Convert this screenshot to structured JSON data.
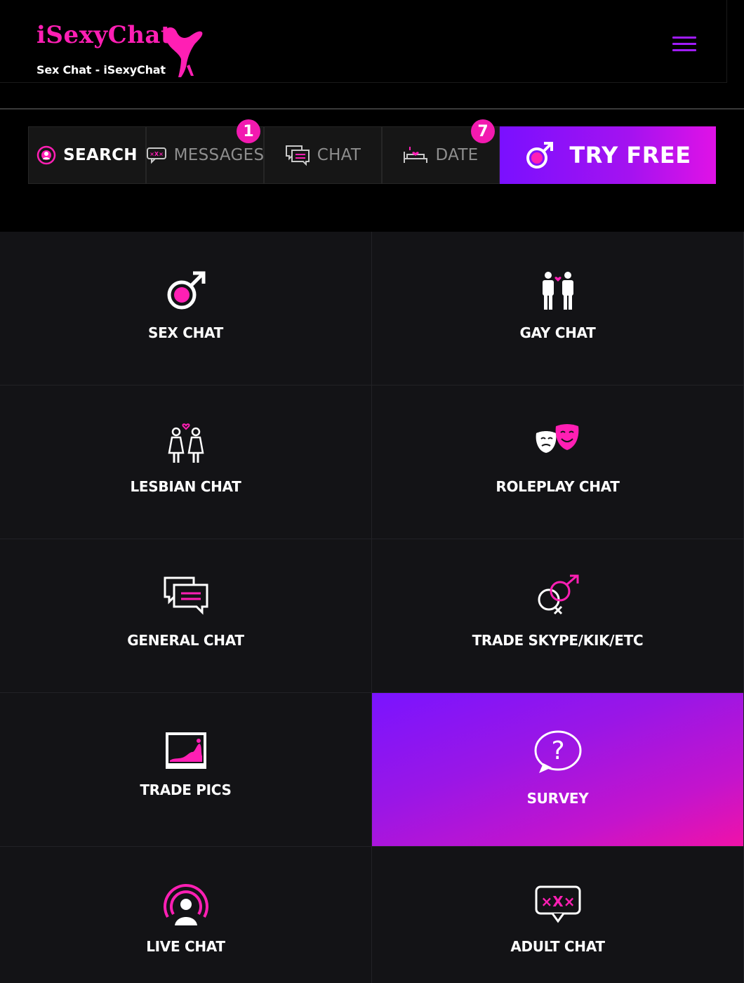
{
  "header": {
    "logo_title": "iSexyChat",
    "logo_subtitle": "Sex Chat - iSexyChat"
  },
  "tabs": [
    {
      "label": "SEARCH",
      "icon": "live-search-icon",
      "active": true
    },
    {
      "label": "MESSAGES",
      "icon": "messages-icon",
      "badge": "1"
    },
    {
      "label": "CHAT",
      "icon": "chat-bubbles-icon"
    },
    {
      "label": "DATE",
      "icon": "bed-icon",
      "badge": "7"
    }
  ],
  "try_free": {
    "label": "TRY FREE",
    "icon": "male-symbol-icon"
  },
  "grid": [
    {
      "label": "SEX CHAT",
      "icon": "male-symbol-icon"
    },
    {
      "label": "GAY CHAT",
      "icon": "two-men-icon"
    },
    {
      "label": "LESBIAN CHAT",
      "icon": "two-women-icon"
    },
    {
      "label": "ROLEPLAY CHAT",
      "icon": "theatre-masks-icon"
    },
    {
      "label": "GENERAL CHAT",
      "icon": "chat-bubbles-icon"
    },
    {
      "label": "TRADE SKYPE/KIK/ETC",
      "icon": "gender-symbols-icon"
    },
    {
      "label": "TRADE PICS",
      "icon": "picture-icon"
    },
    {
      "label": "SURVEY",
      "icon": "question-bubble-icon"
    },
    {
      "label": "LIVE CHAT",
      "icon": "live-broadcast-icon"
    },
    {
      "label": "ADULT CHAT",
      "icon": "xxx-bubble-icon"
    }
  ],
  "colors": {
    "accent_pink": "#ff1fb4",
    "accent_purple": "#7a10ff",
    "menu_purple": "#a01cff",
    "background": "#000000",
    "cell_background": "#131316"
  }
}
